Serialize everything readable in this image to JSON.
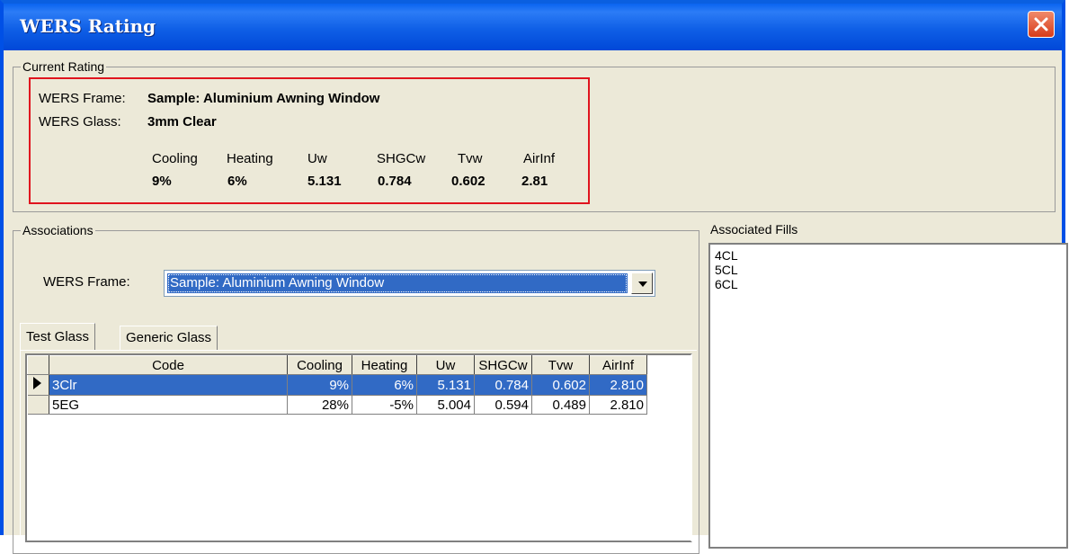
{
  "window": {
    "title": "WERS Rating"
  },
  "current_rating": {
    "legend": "Current Rating",
    "frame_label": "WERS Frame:",
    "frame_value": "Sample: Aluminium Awning Window",
    "glass_label": "WERS Glass:",
    "glass_value": "3mm Clear",
    "metrics": [
      {
        "label": "Cooling",
        "value": "9%"
      },
      {
        "label": "Heating",
        "value": "6%"
      },
      {
        "label": "Uw",
        "value": "5.131"
      },
      {
        "label": "SHGCw",
        "value": "0.784"
      },
      {
        "label": "Tvw",
        "value": "0.602"
      },
      {
        "label": "AirInf",
        "value": "2.81"
      }
    ]
  },
  "associations": {
    "legend": "Associations",
    "frame_label": "WERS Frame:",
    "frame_selected": "Sample: Aluminium Awning Window",
    "tabs": [
      {
        "label": "Test Glass",
        "active": true
      },
      {
        "label": "Generic Glass",
        "active": false
      }
    ],
    "grid": {
      "columns": [
        "Code",
        "Cooling",
        "Heating",
        "Uw",
        "SHGCw",
        "Tvw",
        "AirInf"
      ],
      "rows": [
        {
          "code": "3Clr",
          "cooling": "9%",
          "heating": "6%",
          "uw": "5.131",
          "shgcw": "0.784",
          "tvw": "0.602",
          "airinf": "2.810",
          "selected": true
        },
        {
          "code": "5EG",
          "cooling": "28%",
          "heating": "-5%",
          "uw": "5.004",
          "shgcw": "0.594",
          "tvw": "0.489",
          "airinf": "2.810",
          "selected": false
        }
      ]
    }
  },
  "associated_fills": {
    "legend": "Associated Fills",
    "items": [
      "4CL",
      "5CL",
      "6CL"
    ]
  },
  "colors": {
    "title_bar": "#0a5fe0",
    "selection": "#316ac5",
    "highlight_box": "#e0141e",
    "dialog_bg": "#ece9d8"
  },
  "icons": {
    "close": "close-icon",
    "dropdown": "chevron-down-icon",
    "row_indicator": "row-pointer-icon"
  }
}
